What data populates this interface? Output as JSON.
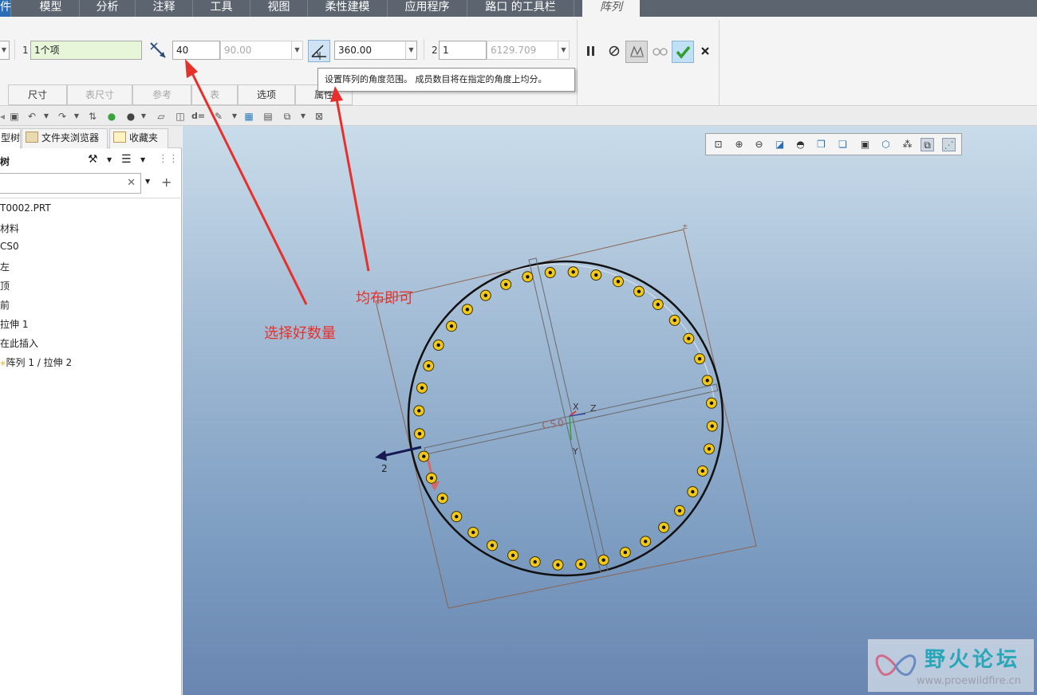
{
  "ribbon_tabs": [
    {
      "label": "件"
    },
    {
      "label": "模型"
    },
    {
      "label": "分析"
    },
    {
      "label": "注释"
    },
    {
      "label": "工具"
    },
    {
      "label": "视图"
    },
    {
      "label": "柔性建模"
    },
    {
      "label": "应用程序"
    },
    {
      "label": "路口 的工具栏"
    },
    {
      "label": "阵列"
    }
  ],
  "dashboard": {
    "dir1_num": "1",
    "dir1_ref": "1个项",
    "count": "40",
    "spacing_angle": "90.00",
    "range_angle": "360.00",
    "dir2_num": "2",
    "dir2_count": "1",
    "dir2_spacing": "6129.709",
    "dir1_caret": "▼",
    "dd_caret": "▼"
  },
  "subtabs": [
    {
      "label": "尺寸",
      "enabled": true
    },
    {
      "label": "表尺寸",
      "enabled": false
    },
    {
      "label": "参考",
      "enabled": false
    },
    {
      "label": "表",
      "enabled": false
    },
    {
      "label": "选项",
      "enabled": true
    },
    {
      "label": "属性",
      "enabled": true
    }
  ],
  "tooltip": "设置阵列的角度范围。 成员数目将在指定的角度上均分。",
  "panel": {
    "tabs": [
      "型树",
      "文件夹浏览器",
      "收藏夹"
    ],
    "title": "树",
    "tree": [
      "T0002.PRT",
      "材料",
      "CS0",
      "左",
      "顶",
      "前",
      "拉伸 1",
      "在此插入",
      "阵列 1 / 拉伸 2"
    ]
  },
  "viewport": {
    "labels": {
      "x": "X",
      "y": "Y",
      "z": "Z",
      "cs": "CS0",
      "dir": "2"
    }
  },
  "annotations": {
    "count_hint": "选择好数量",
    "evenly_hint": "均布即可"
  },
  "watermark": {
    "name": "野火论坛",
    "url": "www.proewildfire.cn"
  },
  "colors": {
    "accent_red": "#e8302a",
    "ok_green": "#2e9e2e",
    "hole_yellow": "#f2c91a"
  }
}
